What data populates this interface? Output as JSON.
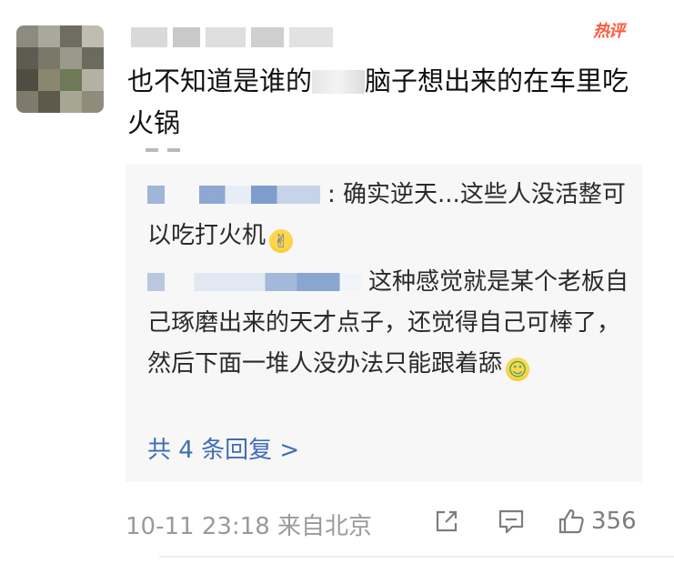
{
  "comment": {
    "hot_badge": "热评",
    "text_before_blur": "也不知道是谁的",
    "text_after_blur": "脑子想出来的在车里吃火锅"
  },
  "replies": [
    {
      "text": ": 确实逆天...这些人没活整可以吃打火机",
      "emoji": "hands-up-emoji"
    },
    {
      "text": "这种感觉就是某个老板自己琢磨出来的天才点子，还觉得自己可棒了，然后下面一堆人没办法只能跟着舔",
      "emoji": "licking-emoji"
    }
  ],
  "view_replies_label": "共 4 条回复 >",
  "footer": {
    "timestamp": "10-11 23:18 来自北京",
    "like_count": "356"
  },
  "icons": {
    "share": "share-icon",
    "comment": "comment-icon",
    "like": "thumbs-up-icon"
  },
  "colors": {
    "link_blue": "#3f6eb5",
    "hot_badge_red": "#ff5a3c",
    "reply_bg": "#f7f7f7",
    "muted_gray": "#9a9a9a"
  }
}
